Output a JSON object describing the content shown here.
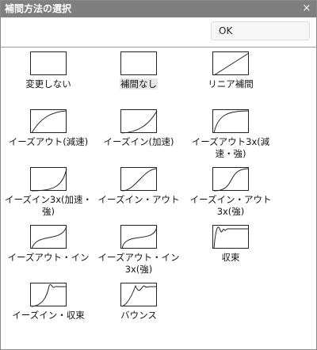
{
  "window": {
    "title": "補間方法の選択",
    "close_glyph": "×",
    "ok_label": "OK"
  },
  "options": [
    {
      "label": "変更しない",
      "curve": "none",
      "selected": false
    },
    {
      "label": "補間なし",
      "curve": "step",
      "selected": true
    },
    {
      "label": "リニア補間",
      "curve": "linear",
      "selected": false
    },
    {
      "label": "イーズアウト(減速)",
      "curve": "ease-out",
      "selected": false
    },
    {
      "label": "イーズイン(加速)",
      "curve": "ease-in",
      "selected": false
    },
    {
      "label": "イーズアウト3x(減速・強)",
      "curve": "ease-out-3x",
      "selected": false
    },
    {
      "label": "イーズイン3x(加速・強)",
      "curve": "ease-in-3x",
      "selected": false
    },
    {
      "label": "イーズイン・アウト",
      "curve": "ease-in-out",
      "selected": false
    },
    {
      "label": "イーズイン・アウト3x(強)",
      "curve": "ease-in-out-3x",
      "selected": false
    },
    {
      "label": "イーズアウト・イン",
      "curve": "ease-out-in",
      "selected": false
    },
    {
      "label": "イーズアウト・イン3x(強)",
      "curve": "ease-out-in-3x",
      "selected": false
    },
    {
      "label": "収束",
      "curve": "converge",
      "selected": false
    },
    {
      "label": "イーズイン・収束",
      "curve": "ease-in-converge",
      "selected": false
    },
    {
      "label": "バウンス",
      "curve": "bounce",
      "selected": false
    }
  ]
}
